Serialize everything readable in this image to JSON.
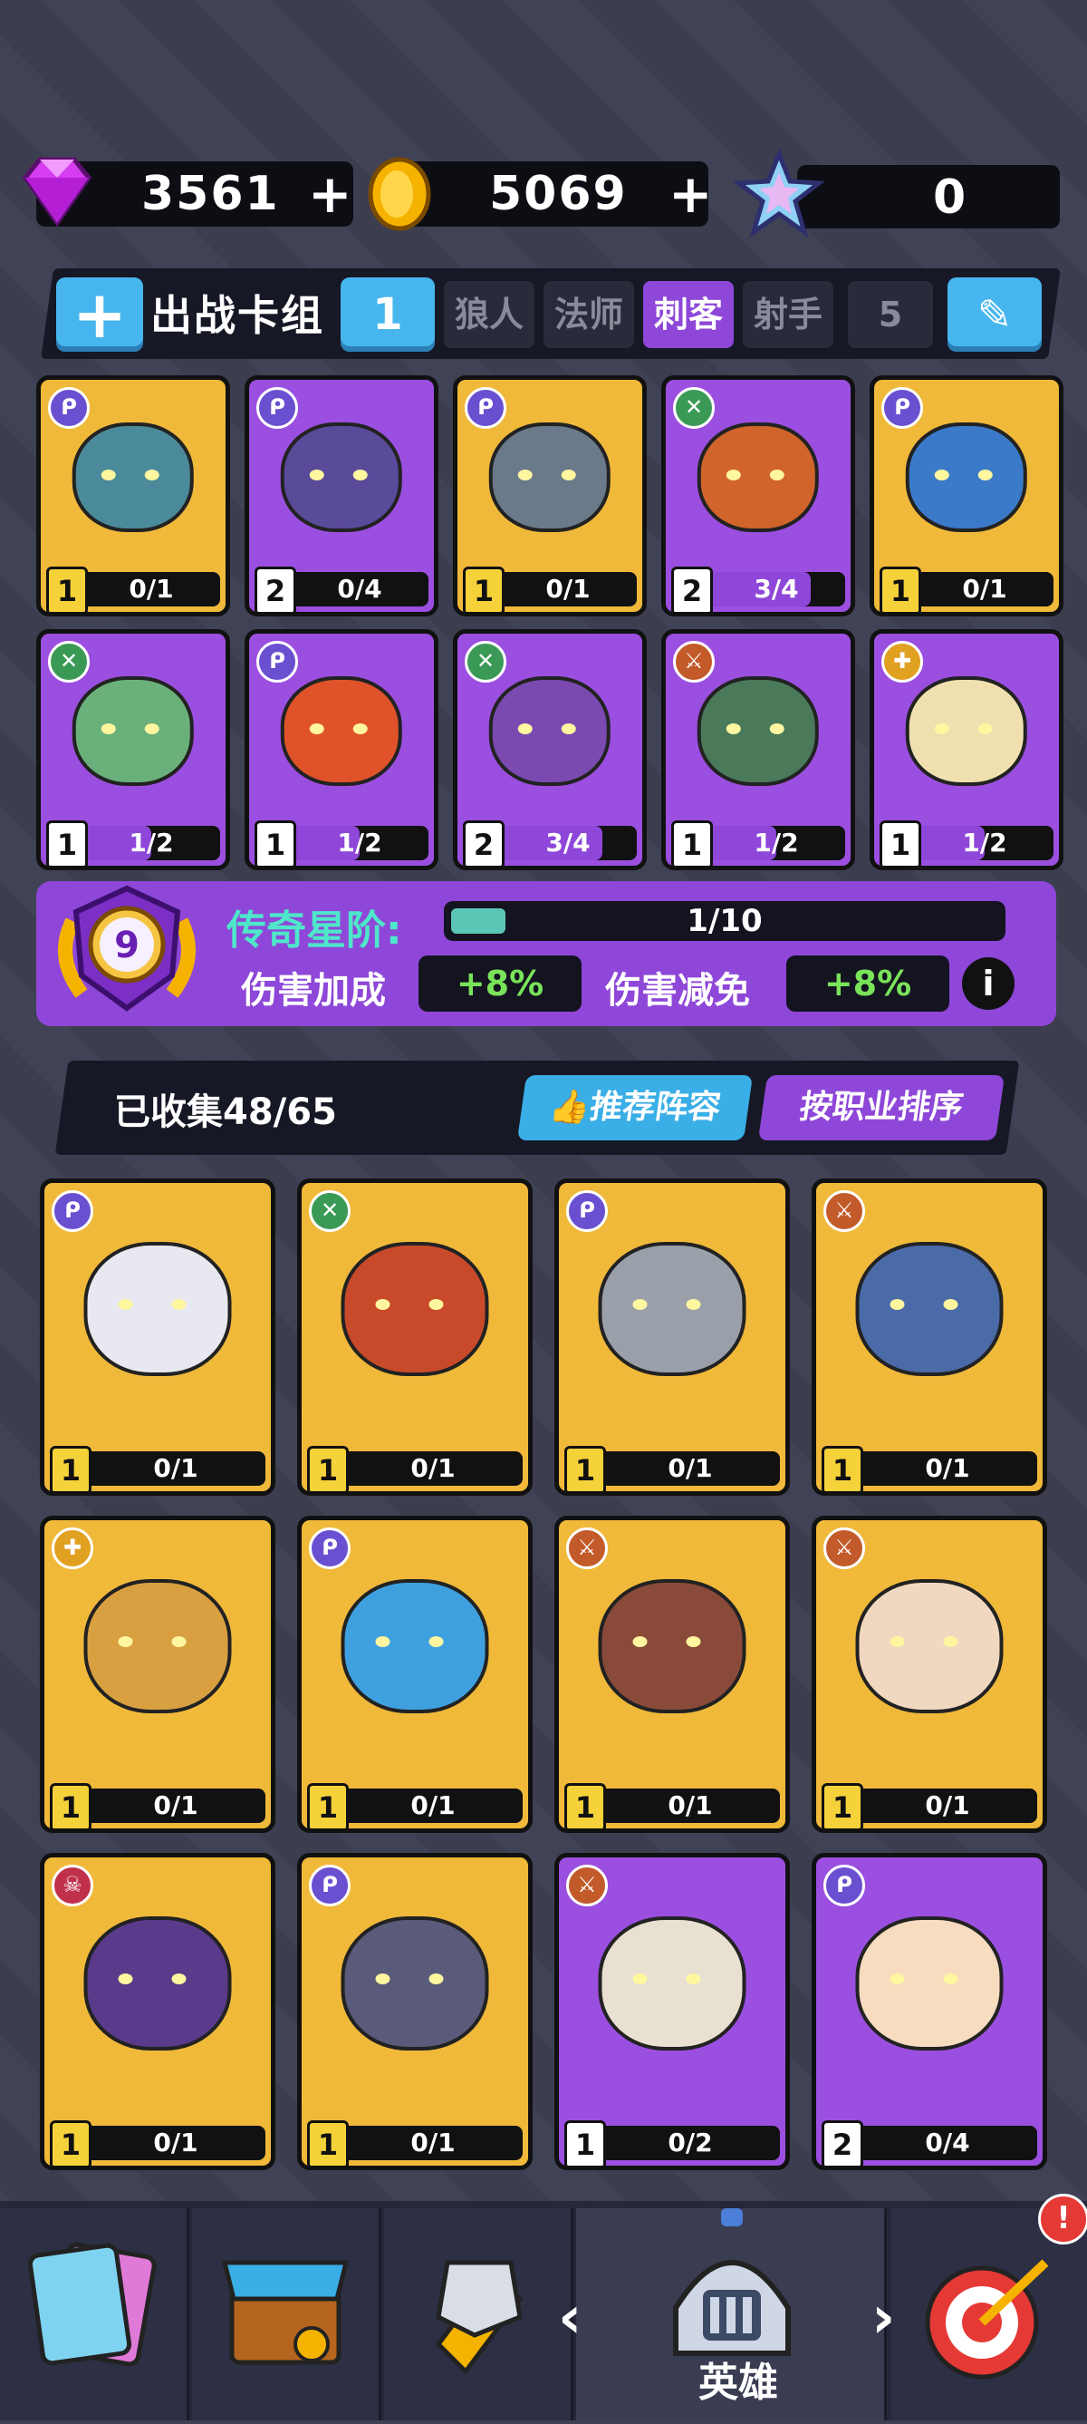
{
  "resources": {
    "gems": "3561",
    "coins": "5069",
    "stars": "0",
    "plus": "+"
  },
  "deck": {
    "title": "出战卡组",
    "cycle": "1",
    "tabs": [
      "狼人",
      "法师",
      "刺客",
      "射手",
      "5"
    ],
    "active_tab": 2,
    "cards": [
      {
        "level": "1",
        "count": "0/1",
        "progress": 0.0,
        "bg": "gold",
        "cls": "mage"
      },
      {
        "level": "2",
        "count": "0/4",
        "progress": 0.0,
        "bg": "purple",
        "cls": "mage"
      },
      {
        "level": "1",
        "count": "0/1",
        "progress": 0.0,
        "bg": "gold",
        "cls": "mage"
      },
      {
        "level": "2",
        "count": "3/4",
        "progress": 0.75,
        "bg": "purple",
        "cls": "archer"
      },
      {
        "level": "1",
        "count": "0/1",
        "progress": 0.0,
        "bg": "gold",
        "cls": "mage"
      },
      {
        "level": "1",
        "count": "1/2",
        "progress": 0.5,
        "bg": "purple",
        "cls": "archer"
      },
      {
        "level": "1",
        "count": "1/2",
        "progress": 0.5,
        "bg": "purple",
        "cls": "mage"
      },
      {
        "level": "2",
        "count": "3/4",
        "progress": 0.75,
        "bg": "purple",
        "cls": "archer"
      },
      {
        "level": "1",
        "count": "1/2",
        "progress": 0.5,
        "bg": "purple",
        "cls": "warrior"
      },
      {
        "level": "1",
        "count": "1/2",
        "progress": 0.5,
        "bg": "purple",
        "cls": "support"
      }
    ]
  },
  "legend": {
    "rank": "9",
    "title": "传奇星阶:",
    "progress_text": "1/10",
    "progress": 0.1,
    "damage_bonus_label": "伤害加成",
    "damage_bonus": "+8%",
    "damage_reduce_label": "伤害减免",
    "damage_reduce": "+8%",
    "info": "i"
  },
  "collection": {
    "collected": "已收集48/65",
    "recommend": "推荐阵容",
    "sort": "按职业排序",
    "cards": [
      {
        "level": "1",
        "count": "0/1",
        "progress": 0.0,
        "bg": "gold",
        "cls": "mage"
      },
      {
        "level": "1",
        "count": "0/1",
        "progress": 0.0,
        "bg": "gold",
        "cls": "archer"
      },
      {
        "level": "1",
        "count": "0/1",
        "progress": 0.0,
        "bg": "gold",
        "cls": "mage"
      },
      {
        "level": "1",
        "count": "0/1",
        "progress": 0.0,
        "bg": "gold",
        "cls": "warrior"
      },
      {
        "level": "1",
        "count": "0/1",
        "progress": 0.0,
        "bg": "gold",
        "cls": "support"
      },
      {
        "level": "1",
        "count": "0/1",
        "progress": 0.0,
        "bg": "gold",
        "cls": "mage"
      },
      {
        "level": "1",
        "count": "0/1",
        "progress": 0.0,
        "bg": "gold",
        "cls": "warrior"
      },
      {
        "level": "1",
        "count": "0/1",
        "progress": 0.0,
        "bg": "gold",
        "cls": "warrior"
      },
      {
        "level": "1",
        "count": "0/1",
        "progress": 0.0,
        "bg": "gold",
        "cls": "demon"
      },
      {
        "level": "1",
        "count": "0/1",
        "progress": 0.0,
        "bg": "gold",
        "cls": "mage"
      },
      {
        "level": "1",
        "count": "0/2",
        "progress": 0.0,
        "bg": "purple",
        "cls": "warrior"
      },
      {
        "level": "2",
        "count": "0/4",
        "progress": 0.0,
        "bg": "purple",
        "cls": "mage"
      }
    ]
  },
  "nav": {
    "hero_label": "英雄",
    "left_arrow": "‹",
    "right_arrow": "›",
    "alert": "!"
  },
  "colors": {
    "gold": "#f0b93a",
    "purple": "#9b4fe0",
    "accent_blue": "#47b6ee",
    "accent_purple": "#8e47d8",
    "green": "#79e35a"
  }
}
